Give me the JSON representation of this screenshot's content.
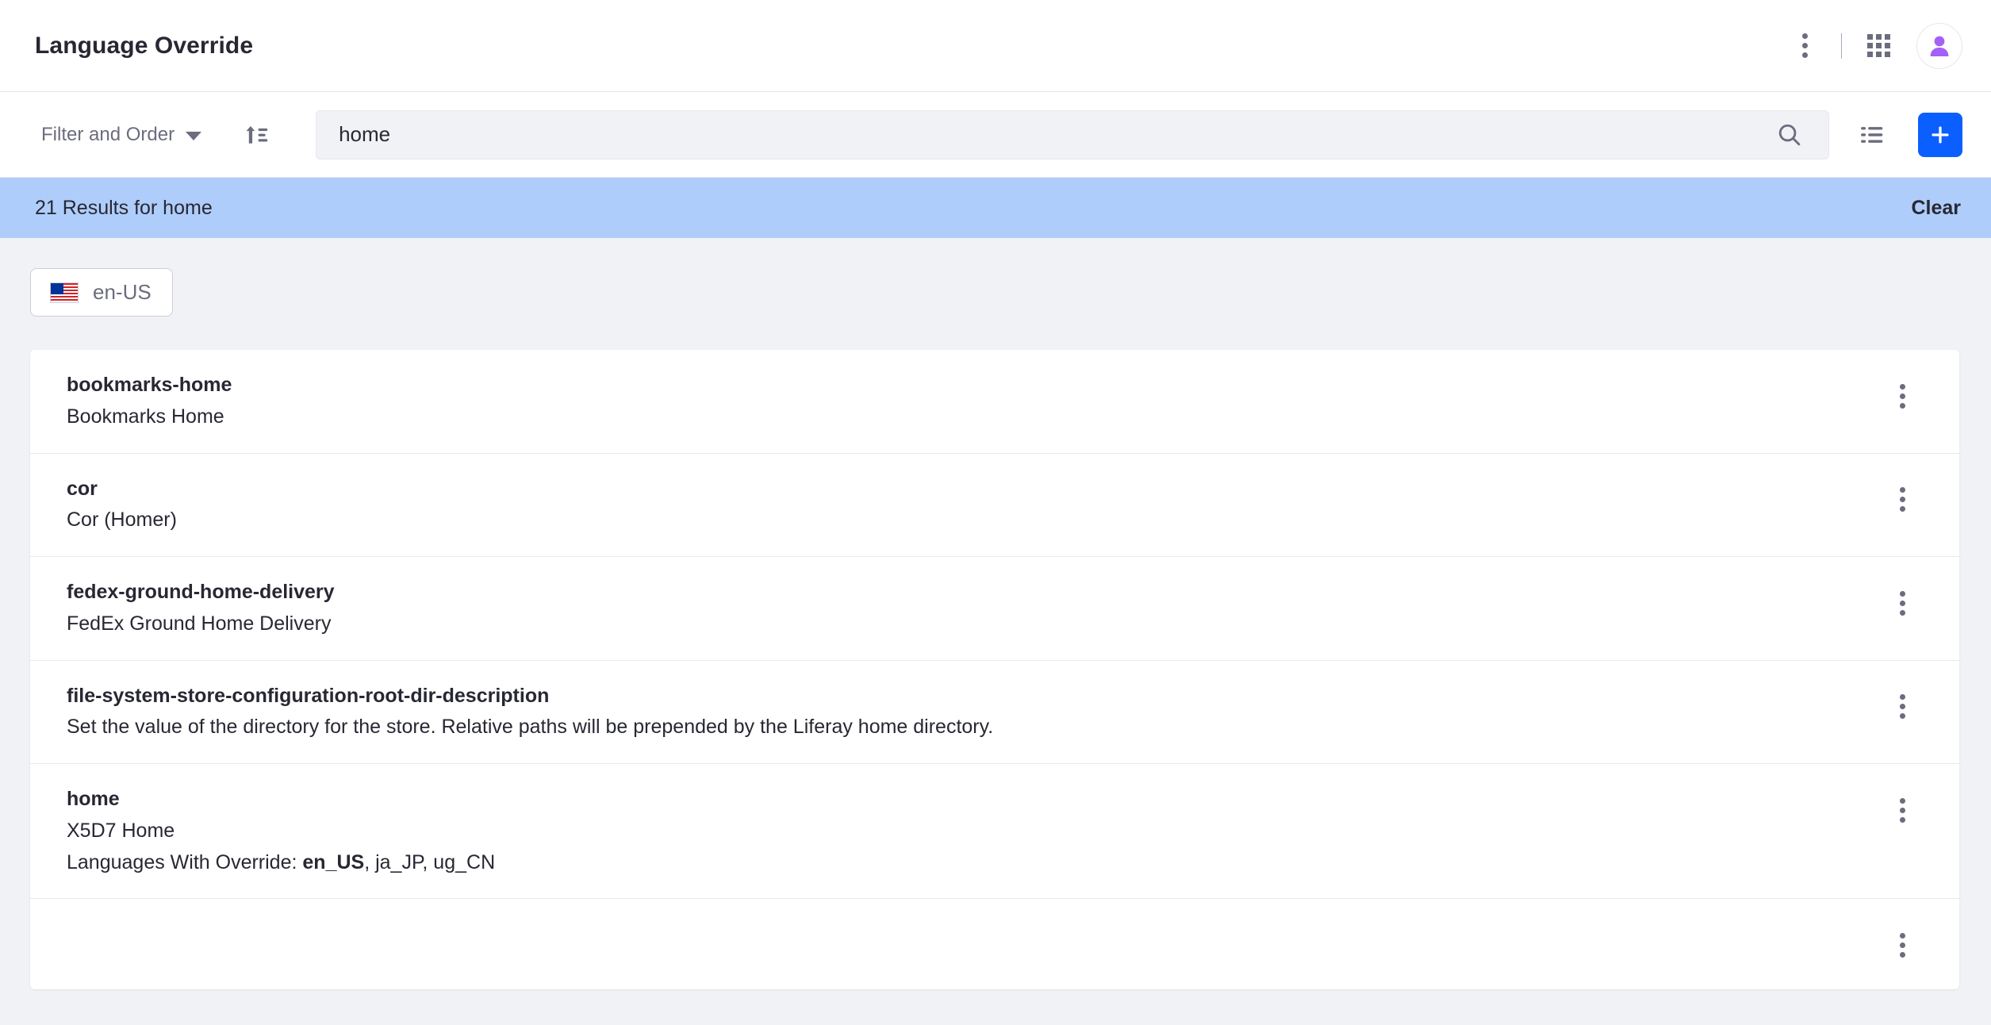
{
  "header": {
    "title": "Language Override",
    "icons": {
      "kebab": "vertical-ellipsis-icon",
      "grid": "applications-grid-icon",
      "avatar": "user-avatar-icon"
    }
  },
  "toolbar": {
    "filter_label": "Filter and Order",
    "sort_icon": "sort-ascending-icon",
    "search_value": "home",
    "search_placeholder": "Search",
    "search_icon": "search-icon",
    "list_view_icon": "list-view-icon",
    "add_button_label": "+"
  },
  "results_bar": {
    "text": "21 Results for home",
    "clear_label": "Clear",
    "background_color": "#afcdfb"
  },
  "locale_chip": {
    "label": "en-US",
    "flag_icon": "us-flag-icon"
  },
  "colors": {
    "accent_blue": "#0b5fff",
    "results_blue": "#afcdfb",
    "text_dark": "#272833",
    "text_muted": "#6b6c7e",
    "page_bg": "#f1f2f5",
    "avatar_purple": "#a362f5"
  },
  "rows": [
    {
      "key": "bookmarks-home",
      "value": "Bookmarks Home",
      "meta_prefix": "",
      "meta_bold": "",
      "meta_suffix": ""
    },
    {
      "key": "cor",
      "value": "Cor (Homer)",
      "meta_prefix": "",
      "meta_bold": "",
      "meta_suffix": ""
    },
    {
      "key": "fedex-ground-home-delivery",
      "value": "FedEx Ground Home Delivery",
      "meta_prefix": "",
      "meta_bold": "",
      "meta_suffix": ""
    },
    {
      "key": "file-system-store-configuration-root-dir-description",
      "value": "Set the value of the directory for the store. Relative paths will be prepended by the Liferay home directory.",
      "meta_prefix": "",
      "meta_bold": "",
      "meta_suffix": ""
    },
    {
      "key": "home",
      "value": "X5D7 Home",
      "meta_prefix": "Languages With Override: ",
      "meta_bold": "en_US",
      "meta_suffix": ", ja_JP, ug_CN"
    }
  ]
}
